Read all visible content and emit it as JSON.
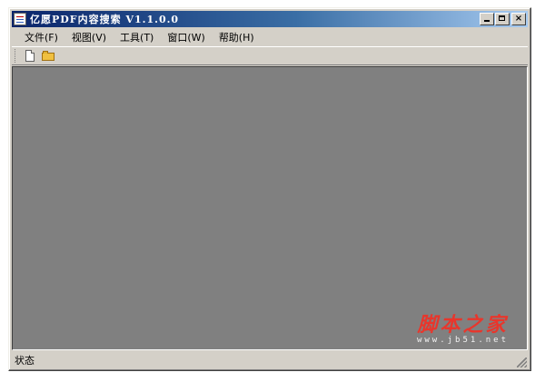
{
  "window": {
    "title": "亿愿PDF内容搜索 V1.1.0.0",
    "minimize_label": "",
    "maximize_label": "",
    "close_label": "×"
  },
  "menu": {
    "items": [
      {
        "label": "文件(F)"
      },
      {
        "label": "视图(V)"
      },
      {
        "label": "工具(T)"
      },
      {
        "label": "窗口(W)"
      },
      {
        "label": "帮助(H)"
      }
    ]
  },
  "toolbar": {
    "buttons": [
      {
        "icon": "new-document-icon"
      },
      {
        "icon": "open-folder-icon"
      }
    ]
  },
  "workspace": {
    "background": "#808080",
    "watermark": {
      "title": "脚本之家",
      "url": "www.jb51.net",
      "color": "#e8362c"
    }
  },
  "statusbar": {
    "text": "状态"
  }
}
